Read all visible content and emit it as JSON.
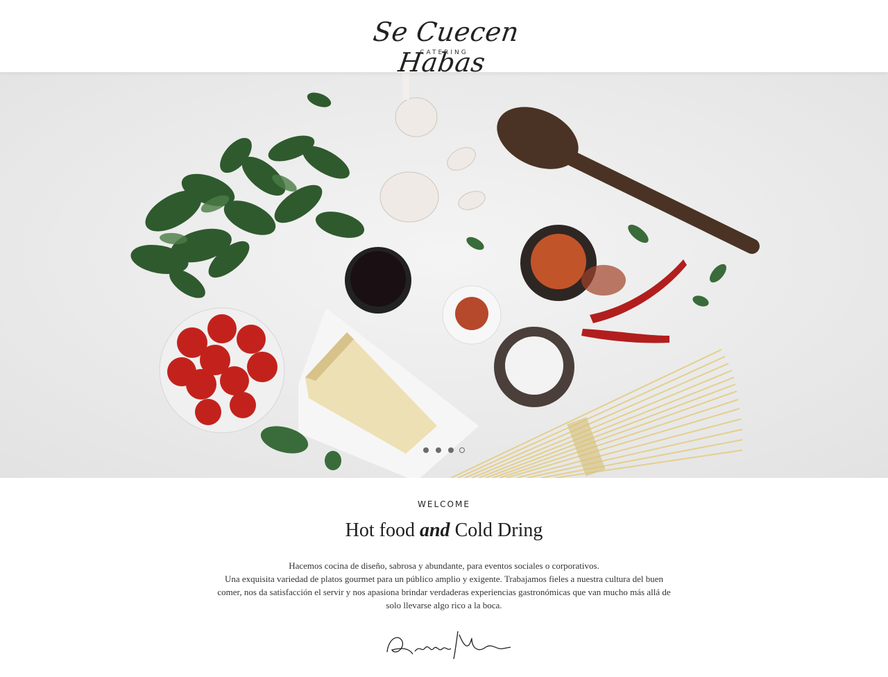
{
  "header": {
    "logo_script": "Se Cuecen Habas",
    "logo_sub": "CATERING"
  },
  "hero": {
    "slides_count": 4,
    "active_slide": 4,
    "image_description_icon": "food-ingredients-image"
  },
  "welcome": {
    "eyebrow": "WELCOME",
    "headline_part1": "Hot food",
    "headline_em": "and",
    "headline_part2": "Cold Dring",
    "paragraph_line1": "Hacemos cocina de diseño, sabrosa y abundante, para eventos sociales o corporativos.",
    "paragraph_line2": "Una exquisita variedad de platos gourmet para un público amplio y exigente. Trabajamos fieles a nuestra cultura del buen comer, nos da satisfacción el servir y nos apasiona brindar verdaderas experiencias gastronómicas que van mucho más allá de solo llevarse algo rico a la boca.",
    "signature_text": "Richard Nixon"
  },
  "colors": {
    "hero_bg": "#ececec",
    "text": "#1f1f1f",
    "dot": "#6b6b6b"
  }
}
